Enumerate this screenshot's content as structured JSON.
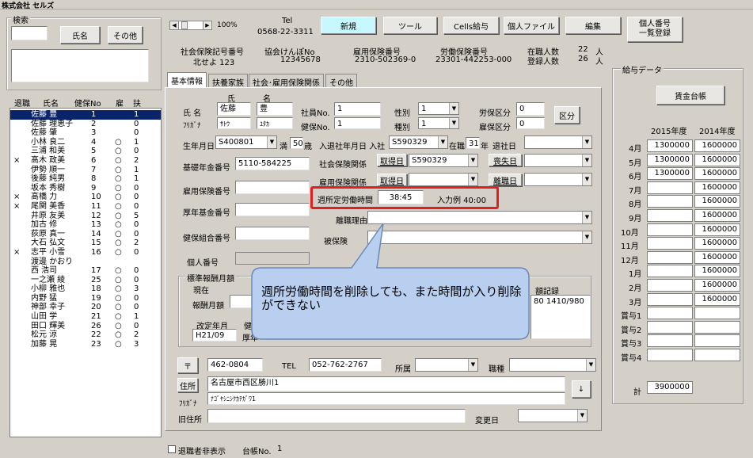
{
  "title": "株式会社 セルズ",
  "search": {
    "group_label": "検索",
    "name_btn": "氏名",
    "other_btn": "その他"
  },
  "list": {
    "headers": [
      "退職",
      "氏名",
      "健保No",
      "雇",
      "扶"
    ],
    "rows": [
      {
        "t": "",
        "n": "佐藤 豊",
        "k": "1",
        "y": "",
        "f": "1"
      },
      {
        "t": "",
        "n": "佐藤 理恵子",
        "k": "2",
        "y": "",
        "f": "0"
      },
      {
        "t": "",
        "n": "佐藤 肇",
        "k": "3",
        "y": "",
        "f": "0"
      },
      {
        "t": "",
        "n": "小林 良二",
        "k": "4",
        "y": "○",
        "f": "1"
      },
      {
        "t": "",
        "n": "三浦 和美",
        "k": "5",
        "y": "○",
        "f": "0"
      },
      {
        "t": "×",
        "n": "髙木 政美",
        "k": "6",
        "y": "○",
        "f": "2"
      },
      {
        "t": "",
        "n": "伊勢 順一",
        "k": "7",
        "y": "○",
        "f": "1"
      },
      {
        "t": "",
        "n": "後藤 純男",
        "k": "8",
        "y": "○",
        "f": "1"
      },
      {
        "t": "",
        "n": "坂本 秀樹",
        "k": "9",
        "y": "○",
        "f": "0"
      },
      {
        "t": "×",
        "n": "髙橋 力",
        "k": "10",
        "y": "○",
        "f": "0"
      },
      {
        "t": "×",
        "n": "尾関 美香",
        "k": "11",
        "y": "○",
        "f": "0"
      },
      {
        "t": "",
        "n": "井原 友美",
        "k": "12",
        "y": "○",
        "f": "5"
      },
      {
        "t": "",
        "n": "加古 修",
        "k": "13",
        "y": "○",
        "f": "0"
      },
      {
        "t": "",
        "n": "荻原 真一",
        "k": "14",
        "y": "○",
        "f": "0"
      },
      {
        "t": "",
        "n": "大石 弘文",
        "k": "15",
        "y": "○",
        "f": "2"
      },
      {
        "t": "×",
        "n": "志平 小雪",
        "k": "16",
        "y": "○",
        "f": "0"
      },
      {
        "t": "",
        "n": "渡邊 かおり",
        "k": "",
        "y": "",
        "f": ""
      },
      {
        "t": "",
        "n": "西 浩司",
        "k": "17",
        "y": "○",
        "f": "0"
      },
      {
        "t": "",
        "n": "一之瀬 綾",
        "k": "25",
        "y": "○",
        "f": "0"
      },
      {
        "t": "",
        "n": "小柳 雅也",
        "k": "18",
        "y": "○",
        "f": "3"
      },
      {
        "t": "",
        "n": "内野 猛",
        "k": "19",
        "y": "○",
        "f": "0"
      },
      {
        "t": "",
        "n": "神部 幸子",
        "k": "20",
        "y": "○",
        "f": "0"
      },
      {
        "t": "",
        "n": "山田 学",
        "k": "21",
        "y": "○",
        "f": "1"
      },
      {
        "t": "",
        "n": "田口 輝美",
        "k": "26",
        "y": "○",
        "f": "0"
      },
      {
        "t": "",
        "n": "松元 涼",
        "k": "22",
        "y": "○",
        "f": "2"
      },
      {
        "t": "",
        "n": "加藤 晃",
        "k": "23",
        "y": "○",
        "f": "3"
      }
    ]
  },
  "toolbar": {
    "zoom": "100%",
    "tel_label": "Tel",
    "tel": "0568-22-3311",
    "new": "新規",
    "tools": "ツール",
    "cells": "Cells給与",
    "personal_file": "個人ファイル",
    "edit": "編集",
    "personal_no1": "個人番号",
    "personal_no2": "一覧登録"
  },
  "company": {
    "shaho_label": "社会保険記号番号",
    "shaho": "北せよ 123",
    "kyokai_label": "協会けんぽNo",
    "kyokai": "12345678",
    "koyo_label": "雇用保険番号",
    "koyo": "2310-502369-0",
    "rodo_label": "労働保険番号",
    "rodo": "23301-442253-000",
    "zaishoku_label": "在職人数",
    "zaishoku": "22",
    "toroku_label": "登録人数",
    "toroku": "26",
    "unit": "人"
  },
  "tabs": [
    "基本情報",
    "扶養家族",
    "社会･雇用保険関係",
    "その他"
  ],
  "basic": {
    "shi": "氏",
    "mei": "名",
    "name_label": "氏 名",
    "furigana_label": "ﾌﾘｶﾞﾅ",
    "last": "佐藤",
    "first": "豊",
    "last_kana": "ｻﾄｳ",
    "first_kana": "ﾕﾀｶ",
    "emp_no_label": "社員No.",
    "emp_no": "1",
    "kenpo_no_label": "健保No.",
    "kenpo_no": "1",
    "gender_label": "性別",
    "gender": "1",
    "shubetsu_label": "種別",
    "shubetsu": "1",
    "rodo_kubun_label": "労保区分",
    "rodo_kubun": "0",
    "koyo_kubun_label": "雇保区分",
    "koyo_kubun": "0",
    "kubun_btn": "区分",
    "birth_label": "生年月日",
    "birth": "S400801",
    "age_prefix": "満",
    "age": "50",
    "age_unit": "歳",
    "nyutai_label": "入退社年月日 入社",
    "nyusha": "S590329",
    "zaishoku_label": "在職",
    "zaishoku": "31",
    "year_unit": "年",
    "taisha_label": "退社日",
    "kiso_label": "基礎年金番号",
    "kiso": "5110-584225",
    "shaho_kankei_label": "社会保険関係",
    "shutoku_btn": "取得日",
    "shutoku": "S590329",
    "soshitsu_btn": "喪失日",
    "koyo_no_label": "雇用保険番号",
    "koyo_kankei_label": "雇用保険関係",
    "shutoku2_btn": "取得日",
    "rishoku_btn": "離職日",
    "weekly_label": "週所定労働時間",
    "weekly": "38:45",
    "example": "入力例 40:00",
    "kousei_label": "厚年基金番号",
    "rishoku_riyu_label": "離職理由",
    "hiho_label": "被保険",
    "kenpo_kumiai_label": "健保組合番号",
    "kojin_label": "個人番号",
    "hyojun_label": "標準報酬月額",
    "genzai_label": "現在",
    "hoshu_label": "報酬月額",
    "kaitei_label": "改定年月",
    "kaitei": "H21/09",
    "kou_label": "健",
    "kounen_label": "厚年",
    "kiroku_label": "額記録",
    "kiroku": "80 1410/980"
  },
  "address": {
    "zip_btn": "〒",
    "zip": "462-0804",
    "tel_label": "TEL",
    "tel": "052-762-2767",
    "shozoku_label": "所属",
    "shokushu_label": "職種",
    "addr_btn": "住所",
    "addr": "名古屋市西区勝川1",
    "addr_kana_label": "ﾌﾘｶﾞﾅ",
    "addr_kana": "ﾅｺﾞﾔｼﾆｼｸｶﾁｶﾞﾜ1",
    "old_addr_label": "旧住所",
    "henko_label": "変更日"
  },
  "footer": {
    "hide_retired": "退職者非表示",
    "daicho_label": "台帳No.",
    "daicho": "1"
  },
  "salary": {
    "group_label": "給与データ",
    "ledger_btn": "賃金台帳",
    "year1": "2015年度",
    "year2": "2014年度",
    "rows": [
      {
        "m": "4月",
        "a": "1300000",
        "b": "1600000"
      },
      {
        "m": "5月",
        "a": "1300000",
        "b": "1600000"
      },
      {
        "m": "6月",
        "a": "1300000",
        "b": "1600000"
      },
      {
        "m": "7月",
        "a": "",
        "b": "1600000"
      },
      {
        "m": "8月",
        "a": "",
        "b": "1600000"
      },
      {
        "m": "9月",
        "a": "",
        "b": "1600000"
      },
      {
        "m": "10月",
        "a": "",
        "b": "1600000"
      },
      {
        "m": "11月",
        "a": "",
        "b": "1600000"
      },
      {
        "m": "12月",
        "a": "",
        "b": "1600000"
      },
      {
        "m": "1月",
        "a": "",
        "b": "1600000"
      },
      {
        "m": "2月",
        "a": "",
        "b": "1600000"
      },
      {
        "m": "3月",
        "a": "",
        "b": "1600000"
      },
      {
        "m": "賞与1",
        "a": "",
        "b": ""
      },
      {
        "m": "賞与2",
        "a": "",
        "b": ""
      },
      {
        "m": "賞与3",
        "a": "",
        "b": ""
      },
      {
        "m": "賞与4",
        "a": "",
        "b": ""
      }
    ],
    "total_label": "計",
    "total": "3900000"
  },
  "callout": {
    "text": "週所労働時間を削除しても、また時間が入り削除ができない"
  }
}
